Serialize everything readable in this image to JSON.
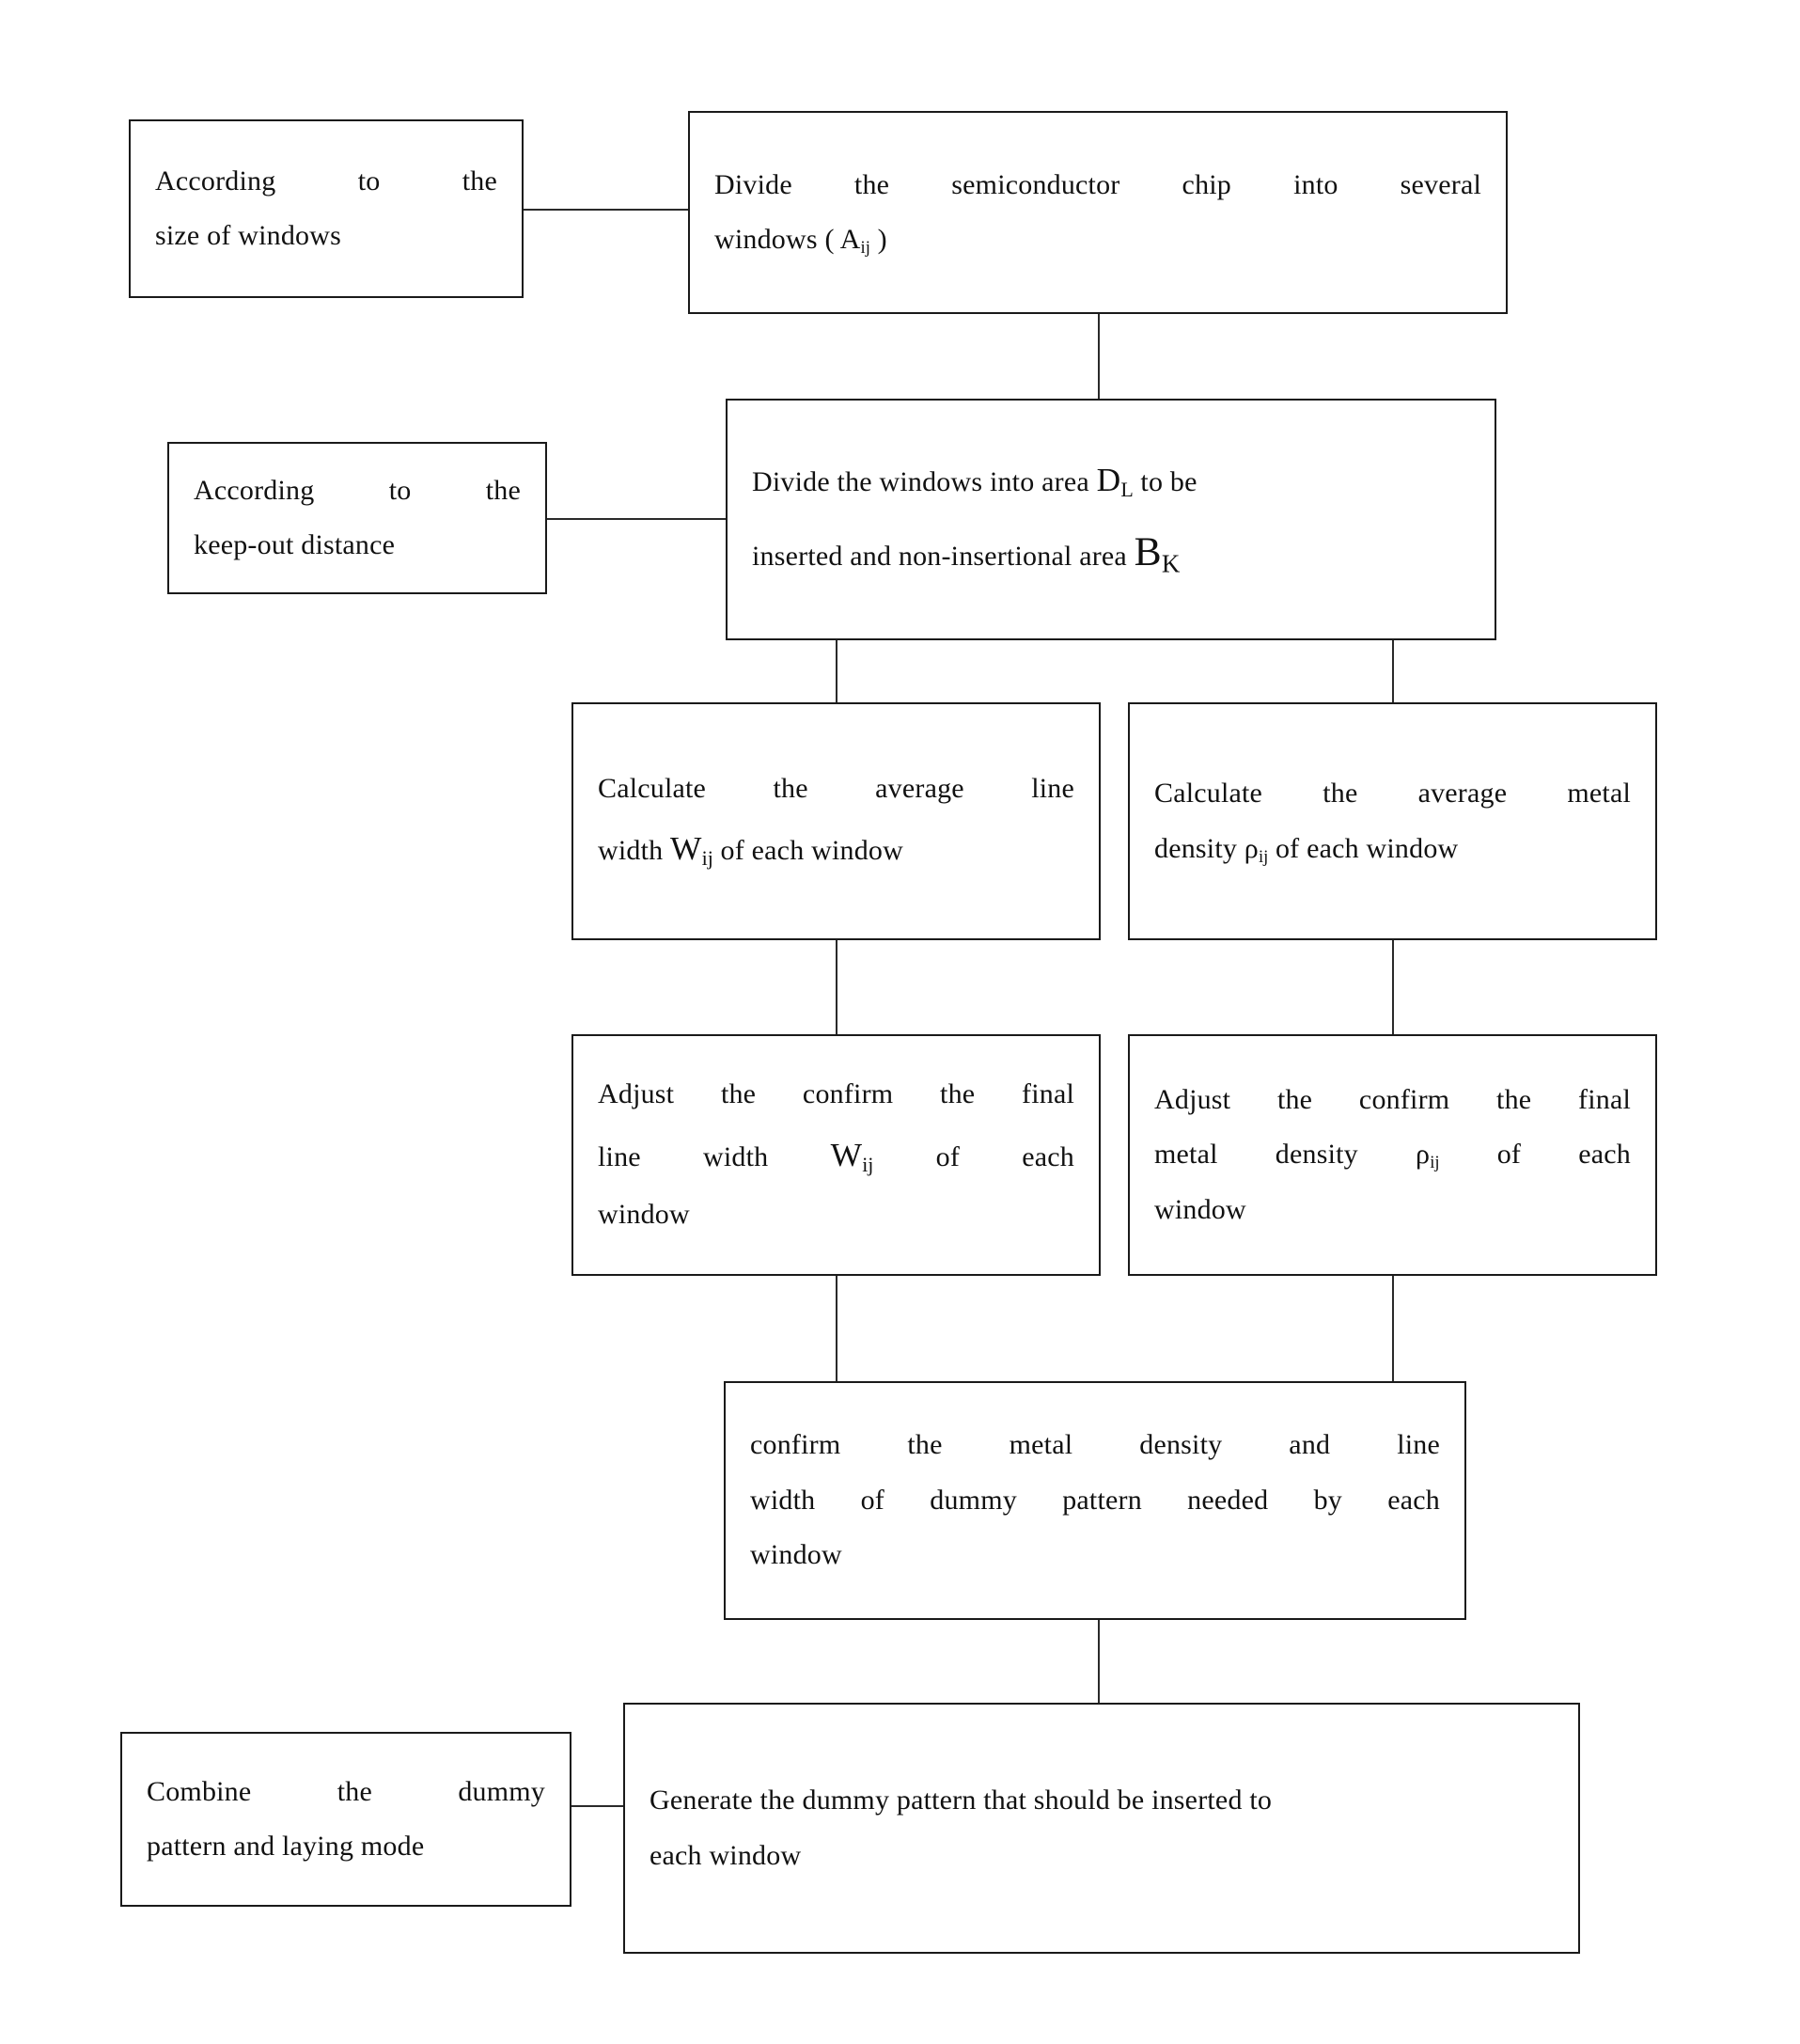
{
  "diagram": {
    "title": "Dummy pattern insertion flowchart",
    "type": "flowchart",
    "colors": {
      "border": "#1a1a1a",
      "connector": "#2a2a2a",
      "background": "#ffffff",
      "text": "#111111"
    },
    "nodes": {
      "side_window_size": {
        "line1": "According to the",
        "line2": "size of windows"
      },
      "divide_chip": {
        "line1": "Divide the semiconductor chip into several",
        "line2_pre": "windows ( A",
        "line2_sub": "ij",
        "line2_post": " )"
      },
      "side_keepout": {
        "line1": "According to the",
        "line2": "keep-out distance"
      },
      "divide_windows": {
        "line1_pre": "Divide the windows into area ",
        "line1_var": "D",
        "line1_sub": "L",
        "line1_post": "  to be",
        "line2_pre": "inserted and non-insertional area ",
        "line2_var": "B",
        "line2_sub": "K"
      },
      "calc_line_width": {
        "line1": "Calculate the average line",
        "line2_pre": "width ",
        "line2_var": "W",
        "line2_sub": "ij",
        "line2_post": " of each window"
      },
      "calc_metal_density": {
        "line1": "Calculate the average metal",
        "line2_pre": "density ",
        "line2_var": "ρ",
        "line2_sub": "ij",
        "line2_post": "  of each window"
      },
      "adjust_line_width": {
        "line1": "Adjust the confirm the final",
        "line2_pre": "line width ",
        "line2_var": "W",
        "line2_sub": "ij",
        "line2_post": "  of each",
        "line3": "window"
      },
      "adjust_metal_density": {
        "line1": "Adjust the confirm the final",
        "line2_pre": "metal density ",
        "line2_var": "ρ",
        "line2_sub": "ij",
        "line2_post": "  of each",
        "line3": "window"
      },
      "confirm_density_width": {
        "line1": "confirm the metal density and line",
        "line2": "width of dummy pattern needed by each",
        "line3": "window"
      },
      "side_combine": {
        "line1": "Combine the dummy",
        "line2": "pattern and laying mode"
      },
      "generate_dummy": {
        "line1": "Generate the dummy pattern that should be inserted to",
        "line2": "each window"
      }
    }
  }
}
